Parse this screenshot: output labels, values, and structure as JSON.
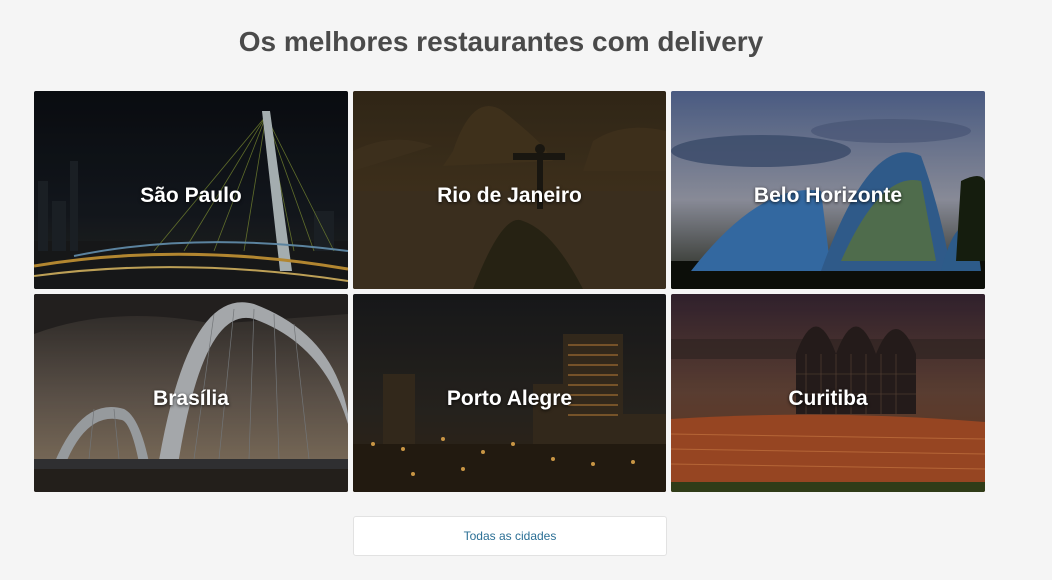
{
  "header": {
    "title": "Os melhores restaurantes com delivery"
  },
  "cities": [
    {
      "name": "São Paulo",
      "scene": "bridge-night-icon"
    },
    {
      "name": "Rio de Janeiro",
      "scene": "christ-redeemer-icon"
    },
    {
      "name": "Belo Horizonte",
      "scene": "pampulha-church-icon"
    },
    {
      "name": "Brasília",
      "scene": "arch-bridge-icon"
    },
    {
      "name": "Porto Alegre",
      "scene": "city-night-icon"
    },
    {
      "name": "Curitiba",
      "scene": "botanical-garden-icon"
    }
  ],
  "footer": {
    "all_cities_label": "Todas as cidades"
  },
  "colors": {
    "background": "#f5f5f5",
    "title": "#4a4a4a",
    "link": "#2b6f95"
  }
}
